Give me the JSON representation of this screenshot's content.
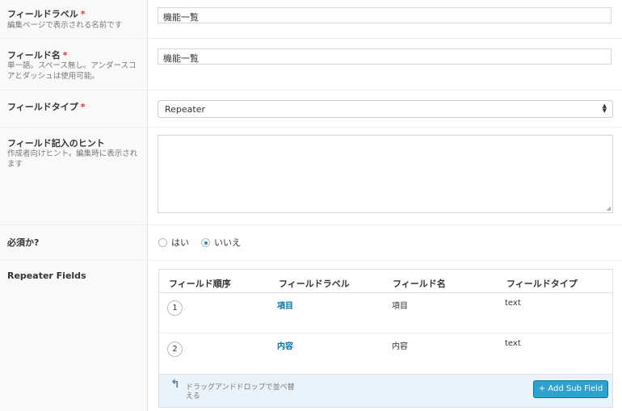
{
  "fields": {
    "label": {
      "title": "フィールドラベル",
      "required": "*",
      "desc": "編集ページで表示される名前です",
      "value": "機能一覧"
    },
    "name": {
      "title": "フィールド名",
      "required": "*",
      "desc": "単一語。スペース無し。アンダースコアとダッシュは使用可能。",
      "value": "機能一覧"
    },
    "type": {
      "title": "フィールドタイプ",
      "required": "*",
      "value": "Repeater"
    },
    "hint": {
      "title": "フィールド記入のヒント",
      "desc": "作成者向けヒント。編集時に表示されます",
      "value": ""
    },
    "required": {
      "title": "必須か?",
      "options": [
        "はい",
        "いいえ"
      ],
      "selected": "いいえ"
    },
    "repeater": {
      "title": "Repeater Fields"
    }
  },
  "repeater_table": {
    "headers": [
      "フィールド順序",
      "フィールドラベル",
      "フィールド名",
      "フィールドタイプ"
    ],
    "rows": [
      {
        "order": "1",
        "label": "項目",
        "name": "項目",
        "type": "text"
      },
      {
        "order": "2",
        "label": "内容",
        "name": "内容",
        "type": "text"
      }
    ],
    "drag_hint": "ドラッグアンドドロップで並べ替える",
    "add_button": "+ Add Sub Field"
  },
  "colors": {
    "accent": "#2ea2cc",
    "link": "#0073aa",
    "required": "#dd3333",
    "footer_bg": "#eaf2fa"
  },
  "icons": {
    "drag": "arrow-up-curved-icon",
    "select": "select-arrows-icon",
    "resize": "resize-handle-icon"
  }
}
